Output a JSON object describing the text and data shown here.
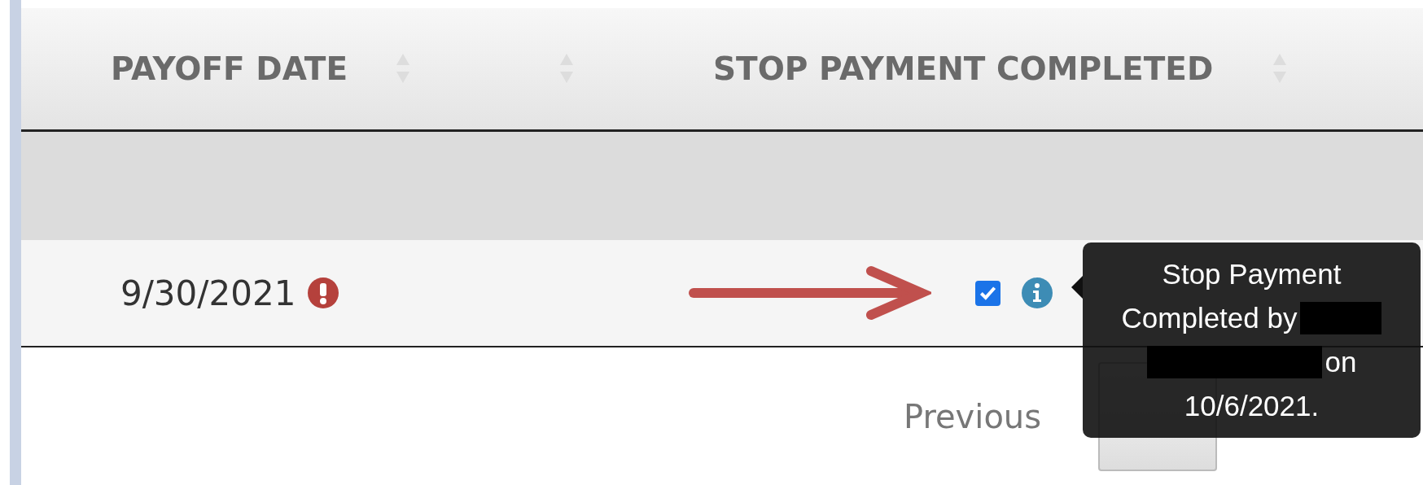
{
  "table": {
    "columns": [
      {
        "label": "PAYOFF DATE",
        "sortable": true
      },
      {
        "sortable": true
      },
      {
        "label": "STOP PAYMENT COMPLETED",
        "sortable": true
      }
    ],
    "rows": [
      {
        "payoff_date": "9/30/2021",
        "warning": true,
        "stop_payment_completed": true,
        "info": true
      }
    ]
  },
  "annotation": {
    "kind": "arrow"
  },
  "tooltip": {
    "lines": [
      [
        {
          "kind": "text",
          "text": "Stop Payment"
        }
      ],
      [
        {
          "kind": "text",
          "text": "Completed by"
        },
        {
          "kind": "redacted"
        }
      ],
      [
        {
          "kind": "redacted"
        },
        {
          "kind": "text",
          "text": "on"
        }
      ],
      [
        {
          "kind": "text",
          "text": "10/6/2021."
        }
      ]
    ]
  },
  "pagination": {
    "previous": "Previous"
  }
}
